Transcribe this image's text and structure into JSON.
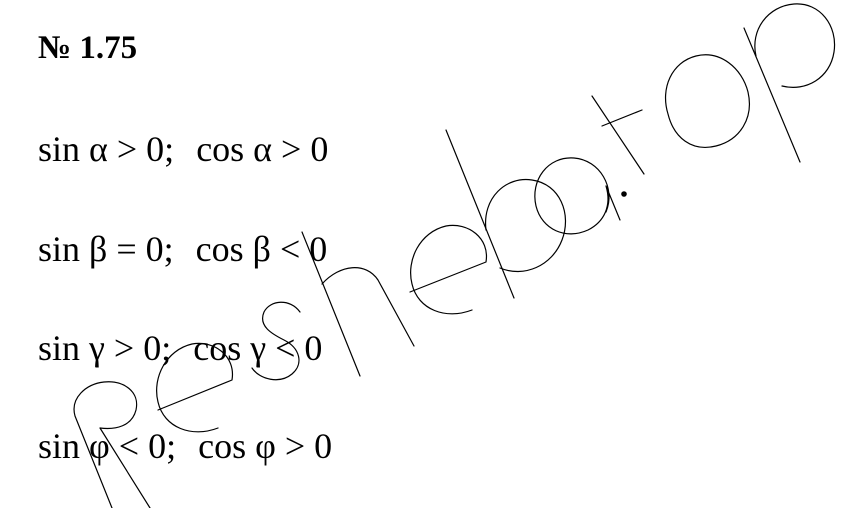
{
  "problem": {
    "number": "№ 1.75"
  },
  "formulas": [
    {
      "first": "sin α > 0;",
      "second": "cos α > 0"
    },
    {
      "first": "sin β = 0;",
      "second": "cos β < 0"
    },
    {
      "first": "sin γ > 0;",
      "second": "cos γ < 0"
    },
    {
      "first": "sin φ < 0;",
      "second": "cos φ > 0"
    }
  ],
  "watermark": {
    "text": "Reshebа.top",
    "stroke_color": "#000000"
  }
}
